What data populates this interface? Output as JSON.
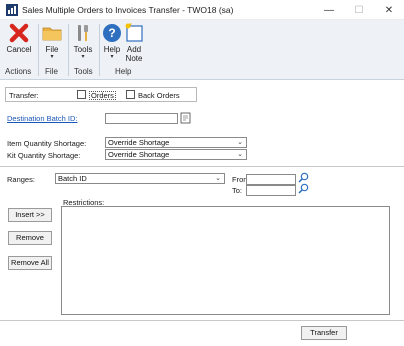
{
  "window": {
    "title": "Sales Multiple Orders to Invoices Transfer  -  TWO18 (sa)",
    "minimize": "—",
    "maximize": "☐",
    "close": "✕"
  },
  "ribbon": {
    "cancel": "Cancel",
    "file": "File",
    "tools": "Tools",
    "help": "Help",
    "add_note_line1": "Add",
    "add_note_line2": "Note",
    "dropdown_arrow": "▾",
    "groups": {
      "actions": "Actions",
      "file": "File",
      "tools": "Tools",
      "help": "Help"
    }
  },
  "transfer": {
    "label": "Transfer:",
    "orders": "Orders",
    "back_orders": "Back Orders",
    "orders_checked": false,
    "back_orders_checked": false
  },
  "batch": {
    "label": "Destination Batch ID:",
    "value": ""
  },
  "shortage": {
    "item_label": "Item Quantity Shortage:",
    "item_value": "Override Shortage",
    "kit_label": "Kit Quantity Shortage:",
    "kit_value": "Override Shortage"
  },
  "ranges": {
    "label": "Ranges:",
    "value": "Batch ID",
    "from_label": "From:",
    "to_label": "To:",
    "from_value": "",
    "to_value": ""
  },
  "restrictions": {
    "label": "Restrictions:",
    "insert": "Insert >>",
    "remove": "Remove",
    "remove_all": "Remove All"
  },
  "footer": {
    "transfer_button": "Transfer"
  },
  "colors": {
    "ribbon_bg": "#eef2f7",
    "cancel_red": "#d7261e",
    "folder_yellow": "#e8b040",
    "help_blue": "#2f6fbf",
    "link_blue": "#1a56b8"
  }
}
